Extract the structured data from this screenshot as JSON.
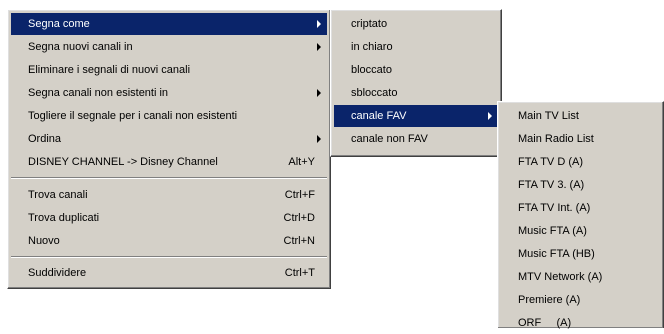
{
  "main_menu": {
    "items": [
      {
        "label": "Segna come",
        "shortcut": "",
        "submenu": true,
        "selected": true
      },
      {
        "label": "Segna nuovi canali in",
        "shortcut": "",
        "submenu": true
      },
      {
        "label": "Eliminare i segnali di nuovi canali",
        "shortcut": "",
        "submenu": false
      },
      {
        "label": "Segna canali non esistenti in",
        "shortcut": "",
        "submenu": true
      },
      {
        "label": "Togliere il segnale per i canali non esistenti",
        "shortcut": "",
        "submenu": false
      },
      {
        "label": "Ordina",
        "shortcut": "",
        "submenu": true
      },
      {
        "label": "DISNEY CHANNEL -> Disney Channel",
        "shortcut": "Alt+Y",
        "submenu": false
      },
      {
        "label": "Trova canali",
        "shortcut": "Ctrl+F",
        "submenu": false
      },
      {
        "label": "Trova duplicati",
        "shortcut": "Ctrl+D",
        "submenu": false
      },
      {
        "label": "Nuovo",
        "shortcut": "Ctrl+N",
        "submenu": false
      },
      {
        "label": "Suddividere",
        "shortcut": "Ctrl+T",
        "submenu": false
      }
    ]
  },
  "submenu_segna_come": {
    "items": [
      {
        "label": "criptato",
        "submenu": false
      },
      {
        "label": "in chiaro",
        "submenu": false
      },
      {
        "label": "bloccato",
        "submenu": false
      },
      {
        "label": "sbloccato",
        "submenu": false
      },
      {
        "label": "canale FAV",
        "submenu": true,
        "selected": true
      },
      {
        "label": "canale non FAV",
        "submenu": false
      }
    ]
  },
  "submenu_canale_fav": {
    "items": [
      {
        "label": "Main TV List"
      },
      {
        "label": "Main Radio List"
      },
      {
        "label": "FTA TV D (A)"
      },
      {
        "label": "FTA TV 3. (A)"
      },
      {
        "label": "FTA TV Int. (A)"
      },
      {
        "label": "Music FTA (A)"
      },
      {
        "label": "Music FTA (HB)"
      },
      {
        "label": "MTV Network (A)"
      },
      {
        "label": "Premiere (A)"
      },
      {
        "label": "ORF     (A)"
      }
    ]
  },
  "colors": {
    "menu_bg": "#d4d0c8",
    "highlight": "#0a246a",
    "highlight_text": "#ffffff"
  }
}
